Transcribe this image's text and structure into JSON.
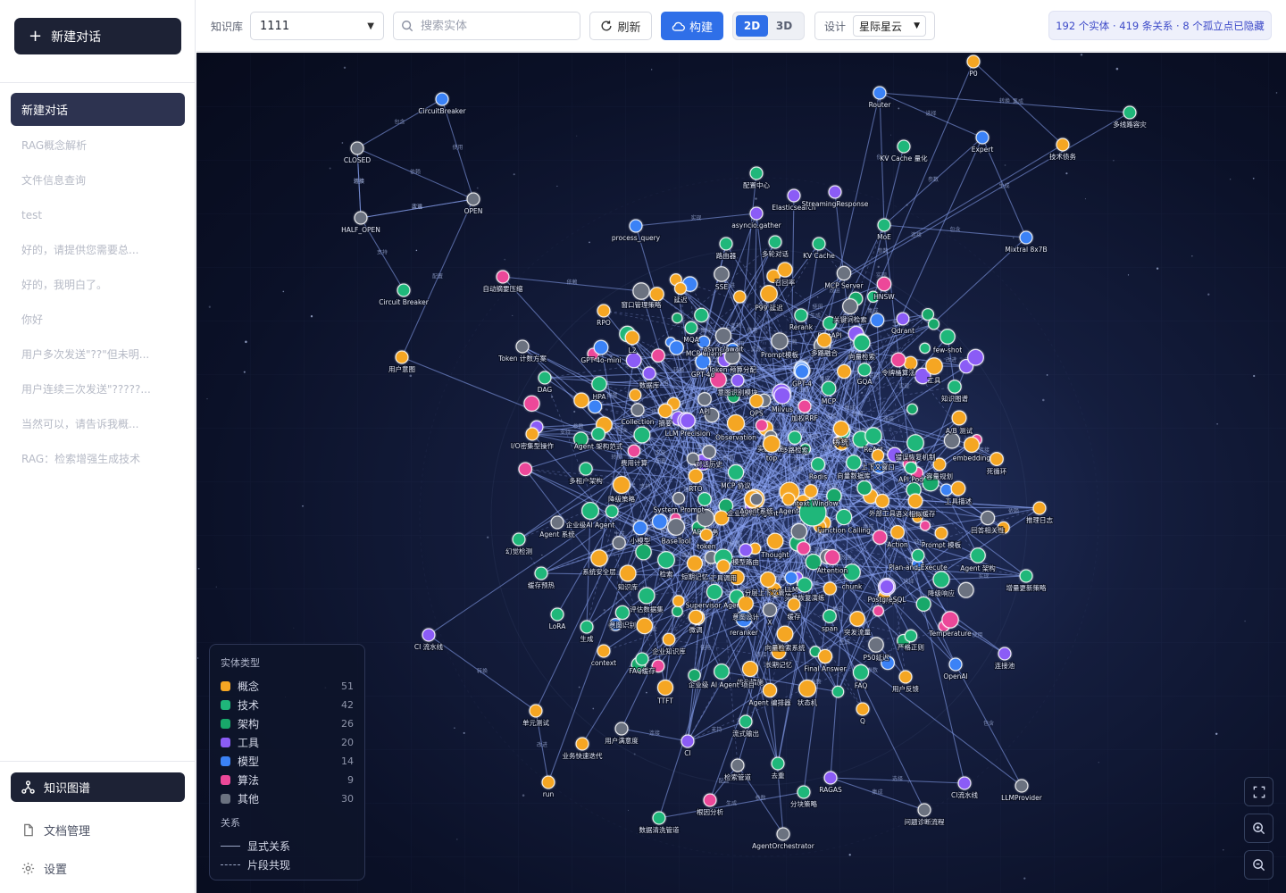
{
  "sidebar": {
    "new_chat_label": "新建对话",
    "conversations": [
      "新建对话",
      "RAG概念解析",
      "文件信息查询",
      "test",
      "好的，请提供您需要总...",
      "好的，我明白了。",
      "你好",
      "用户多次发送\"??\"但未明...",
      "用户连续三次发送\"?????...",
      "当然可以，请告诉我概...",
      "RAG：检索增强生成技术"
    ],
    "nav": [
      "知识图谱",
      "文档管理",
      "设置"
    ]
  },
  "toolbar": {
    "kb_label": "知识库",
    "kb_value": "1111",
    "search_placeholder": "搜索实体",
    "refresh_label": "刷新",
    "build_label": "构建",
    "mode_2d": "2D",
    "mode_3d": "3D",
    "theme_label": "设计",
    "theme_value": "星际星云",
    "stats": "192 个实体 · 419 条关系 · 8 个孤立点已隐藏"
  },
  "legend": {
    "entity_title": "实体类型",
    "types": [
      {
        "name": "概念",
        "count": "51",
        "color": "#f5a623"
      },
      {
        "name": "技术",
        "count": "42",
        "color": "#1fb77a"
      },
      {
        "name": "架构",
        "count": "26",
        "color": "#18a86a"
      },
      {
        "name": "工具",
        "count": "20",
        "color": "#8b5cf6"
      },
      {
        "name": "模型",
        "count": "14",
        "color": "#3b82f6"
      },
      {
        "name": "算法",
        "count": "9",
        "color": "#ec4899"
      },
      {
        "name": "其他",
        "count": "30",
        "color": "#6b7280"
      }
    ],
    "relation_title": "关系",
    "relations": [
      "显式关系",
      "片段共现"
    ]
  },
  "graph": {
    "labeled_nodes": [
      {
        "name": "P0",
        "type": "概念"
      },
      {
        "name": "CircuitBreaker",
        "type": "模型"
      },
      {
        "name": "Router",
        "type": "模型"
      },
      {
        "name": "多线路容灾",
        "type": "技术"
      },
      {
        "name": "CLOSED",
        "type": "其他"
      },
      {
        "name": "OPEN",
        "type": "其他"
      },
      {
        "name": "HALF_OPEN",
        "type": "其他"
      },
      {
        "name": "Circuit Breaker",
        "type": "技术"
      },
      {
        "name": "Expert",
        "type": "模型"
      },
      {
        "name": "技术债务",
        "type": "概念"
      },
      {
        "name": "KV Cache 量化",
        "type": "技术"
      },
      {
        "name": "配置中心",
        "type": "技术"
      },
      {
        "name": "Elasticsearch",
        "type": "工具"
      },
      {
        "name": "StreamingResponse",
        "type": "工具"
      },
      {
        "name": "process_query",
        "type": "模型"
      },
      {
        "name": "asyncio.gather",
        "type": "工具"
      },
      {
        "name": "MoE",
        "type": "技术"
      },
      {
        "name": "Mixtral 8x7B",
        "type": "模型"
      },
      {
        "name": "自动摘要压缩",
        "type": "算法"
      },
      {
        "name": "窗口管理策略",
        "type": "其他"
      },
      {
        "name": "HNSW",
        "type": "算法"
      },
      {
        "name": "RPO",
        "type": "概念"
      },
      {
        "name": "用户意图",
        "type": "概念"
      },
      {
        "name": "Token 计数方案",
        "type": "其他"
      },
      {
        "name": "DAG",
        "type": "技术"
      },
      {
        "name": "GPT-4o-mini",
        "type": "模型"
      },
      {
        "name": "few-shot",
        "type": "技术"
      },
      {
        "name": "知识图谱",
        "type": "技术"
      },
      {
        "name": "A/B 测试",
        "type": "概念"
      },
      {
        "name": "I/O密集型操作",
        "type": "概念"
      },
      {
        "name": "Agent 架构范式",
        "type": "技术"
      },
      {
        "name": "费用计算",
        "type": "算法"
      },
      {
        "name": "embedding",
        "type": "概念"
      },
      {
        "name": "死循环",
        "type": "概念"
      },
      {
        "name": "多租户架构",
        "type": "技术"
      },
      {
        "name": "Context Window",
        "type": "概念"
      },
      {
        "name": "推理日志",
        "type": "概念"
      },
      {
        "name": "回答相关性",
        "type": "其他"
      },
      {
        "name": "Agent 系统",
        "type": "其他"
      },
      {
        "name": "幻觉检测",
        "type": "技术"
      },
      {
        "name": "增量更新策略",
        "type": "技术"
      },
      {
        "name": "Agent 架构",
        "type": "技术"
      },
      {
        "name": "LoRA",
        "type": "技术"
      },
      {
        "name": "CI 流水线",
        "type": "工具"
      },
      {
        "name": "Temperature",
        "type": "算法"
      },
      {
        "name": "连接池",
        "type": "工具"
      },
      {
        "name": "OpenAI",
        "type": "模型"
      },
      {
        "name": "单元测试",
        "type": "概念"
      },
      {
        "name": "用户满意度",
        "type": "其他"
      },
      {
        "name": "业务快速迭代",
        "type": "概念"
      },
      {
        "name": "CI",
        "type": "工具"
      },
      {
        "name": "run",
        "type": "概念"
      },
      {
        "name": "检索管道",
        "type": "其他"
      },
      {
        "name": "去重",
        "type": "技术"
      },
      {
        "name": "RAGAS",
        "type": "工具"
      },
      {
        "name": "根因分析",
        "type": "算法"
      },
      {
        "name": "分块策略",
        "type": "技术"
      },
      {
        "name": "数据清洗管道",
        "type": "技术"
      },
      {
        "name": "AgentOrchestrator",
        "type": "其他"
      },
      {
        "name": "问题诊断流程",
        "type": "其他"
      },
      {
        "name": "CI流水线",
        "type": "工具"
      },
      {
        "name": "LLMProvider",
        "type": "其他"
      },
      {
        "name": "企业级 AI Agent",
        "type": "概念"
      },
      {
        "name": "Agent",
        "type": "概念"
      },
      {
        "name": "RAG",
        "type": "技术"
      },
      {
        "name": "Prompt",
        "type": "工具"
      },
      {
        "name": "Milvus",
        "type": "工具"
      },
      {
        "name": "Redis",
        "type": "技术"
      },
      {
        "name": "向量数据库",
        "type": "技术"
      },
      {
        "name": "ReAct",
        "type": "技术"
      },
      {
        "name": "PostgreSQL",
        "type": "工具"
      },
      {
        "name": "FAQ",
        "type": "技术"
      },
      {
        "name": "Q",
        "type": "概念"
      },
      {
        "name": "用户反馈",
        "type": "概念"
      },
      {
        "name": "P50延迟",
        "type": "其他"
      },
      {
        "name": "严格正则",
        "type": "技术"
      },
      {
        "name": "Final Answer",
        "type": "概念"
      },
      {
        "name": "长期记忆",
        "type": "概念"
      },
      {
        "name": "优化措施",
        "type": "概念"
      },
      {
        "name": "状态机",
        "type": "概念"
      },
      {
        "name": "Agent 编排器",
        "type": "概念"
      },
      {
        "name": "企业级 AI Agent 项目",
        "type": "技术"
      },
      {
        "name": "TTFT",
        "type": "概念"
      },
      {
        "name": "流式输出",
        "type": "技术"
      },
      {
        "name": "context",
        "type": "概念"
      },
      {
        "name": "FAQ缓存",
        "type": "技术"
      },
      {
        "name": "企业知识库",
        "type": "概念"
      },
      {
        "name": "生成",
        "type": "技术"
      },
      {
        "name": "意图识别",
        "type": "技术"
      },
      {
        "name": "缓存预热",
        "type": "技术"
      },
      {
        "name": "系统安全层",
        "type": "概念"
      },
      {
        "name": "知识库",
        "type": "概念"
      },
      {
        "name": "评估数据集",
        "type": "技术"
      },
      {
        "name": "Supervisor Agent",
        "type": "技术"
      },
      {
        "name": "reranker",
        "type": "模型"
      },
      {
        "name": "向量检索系统",
        "type": "概念"
      },
      {
        "name": "突发流量",
        "type": "概念"
      },
      {
        "name": "span",
        "type": "技术"
      },
      {
        "name": "chunk",
        "type": "技术"
      },
      {
        "name": "Thought",
        "type": "概念"
      },
      {
        "name": "Attention",
        "type": "算法"
      },
      {
        "name": "Action",
        "type": "概念"
      },
      {
        "name": "Plan-and-Execute",
        "type": "技术"
      },
      {
        "name": "Prompt 模板",
        "type": "概念"
      },
      {
        "name": "降级响应",
        "type": "技术"
      },
      {
        "name": "工具描述",
        "type": "概念"
      },
      {
        "name": "语义相似缓存",
        "type": "概念"
      },
      {
        "name": "外部工具",
        "type": "概念"
      },
      {
        "name": "Function Calling",
        "type": "技术"
      },
      {
        "name": "API 服务",
        "type": "其他"
      },
      {
        "name": "BaseTool",
        "type": "其他"
      },
      {
        "name": "小模型",
        "type": "模型"
      },
      {
        "name": "System Prompt",
        "type": "其他"
      },
      {
        "name": "降级策略",
        "type": "概念"
      },
      {
        "name": "RTO",
        "type": "概念"
      },
      {
        "name": "MCP 协议",
        "type": "技术"
      },
      {
        "name": "对话历史",
        "type": "其他"
      },
      {
        "name": "LLM Precision",
        "type": "工具"
      },
      {
        "name": "Collection",
        "type": "其他"
      },
      {
        "name": "摘要",
        "type": "概念"
      },
      {
        "name": "HPA",
        "type": "技术"
      },
      {
        "name": "数据库",
        "type": "工具"
      },
      {
        "name": "GPT-4o",
        "type": "模型"
      },
      {
        "name": "Token 预算分配",
        "type": "其他"
      },
      {
        "name": "意图识别模块",
        "type": "工具"
      },
      {
        "name": "GPT-4",
        "type": "模型"
      },
      {
        "name": "MCP",
        "type": "技术"
      },
      {
        "name": "加权RRF",
        "type": "算法"
      },
      {
        "name": "Pod",
        "type": "技术"
      },
      {
        "name": "系统",
        "type": "概念"
      },
      {
        "name": "多路检索",
        "type": "技术"
      },
      {
        "name": "上下文窗口",
        "type": "概念"
      },
      {
        "name": "API Pod",
        "type": "技术"
      },
      {
        "name": "容量规划",
        "type": "概念"
      },
      {
        "name": "错误恢复机制",
        "type": "技术"
      },
      {
        "name": "令牌桶算法",
        "type": "算法"
      },
      {
        "name": "GQA",
        "type": "技术"
      },
      {
        "name": "向量检索",
        "type": "技术"
      },
      {
        "name": "工具",
        "type": "概念"
      },
      {
        "name": "Qdrant",
        "type": "工具"
      },
      {
        "name": "FastAPI",
        "type": "技术"
      },
      {
        "name": "关键词检索",
        "type": "其他"
      },
      {
        "name": "多路融合",
        "type": "概念"
      },
      {
        "name": "Prompt模板",
        "type": "其他"
      },
      {
        "name": "MCP Client",
        "type": "模型"
      },
      {
        "name": "MQA",
        "type": "技术"
      },
      {
        "name": "async/await",
        "type": "其他"
      },
      {
        "name": "召回率",
        "type": "概念"
      },
      {
        "name": "P99 延迟",
        "type": "概念"
      },
      {
        "name": "Rerank",
        "type": "技术"
      },
      {
        "name": "路由器",
        "type": "技术"
      },
      {
        "name": "SSE",
        "type": "其他"
      },
      {
        "name": "延迟",
        "type": "概念"
      },
      {
        "name": "多轮对话",
        "type": "技术"
      },
      {
        "name": "KV Cache",
        "type": "技术"
      },
      {
        "name": "MCP Server",
        "type": "其他"
      },
      {
        "name": "实施措施",
        "type": "其他"
      },
      {
        "name": "意图设计",
        "type": "概念"
      },
      {
        "name": "灾难恢复演练",
        "type": "技术"
      },
      {
        "name": "短期记忆",
        "type": "概念"
      },
      {
        "name": "工具调用",
        "type": "概念"
      },
      {
        "name": "分层上下文管理",
        "type": "概念"
      },
      {
        "name": "模型路由",
        "type": "工具"
      },
      {
        "name": "检索",
        "type": "技术"
      },
      {
        "name": "token",
        "type": "概念"
      },
      {
        "name": "企业级AI Agent",
        "type": "技术"
      },
      {
        "name": "微调",
        "type": "概念"
      },
      {
        "name": "缓存",
        "type": "概念"
      },
      {
        "name": "LLM",
        "type": "模型"
      },
      {
        "name": "Agent系统",
        "type": "其他"
      },
      {
        "name": "X",
        "type": "其他"
      },
      {
        "name": "QPS",
        "type": "概念"
      },
      {
        "name": "top",
        "type": "概念"
      },
      {
        "name": "API",
        "type": "其他"
      },
      {
        "name": "L2",
        "type": "概念"
      },
      {
        "name": "Observation",
        "type": "概念"
      }
    ],
    "edge_labels": [
      "包含",
      "使用",
      "依赖",
      "实现",
      "转换",
      "改进",
      "连接",
      "支持",
      "配置",
      "选择",
      "集成",
      "生成",
      "参数"
    ]
  },
  "controls": [
    "fullscreen-icon",
    "zoom-in-icon",
    "zoom-out-icon"
  ]
}
